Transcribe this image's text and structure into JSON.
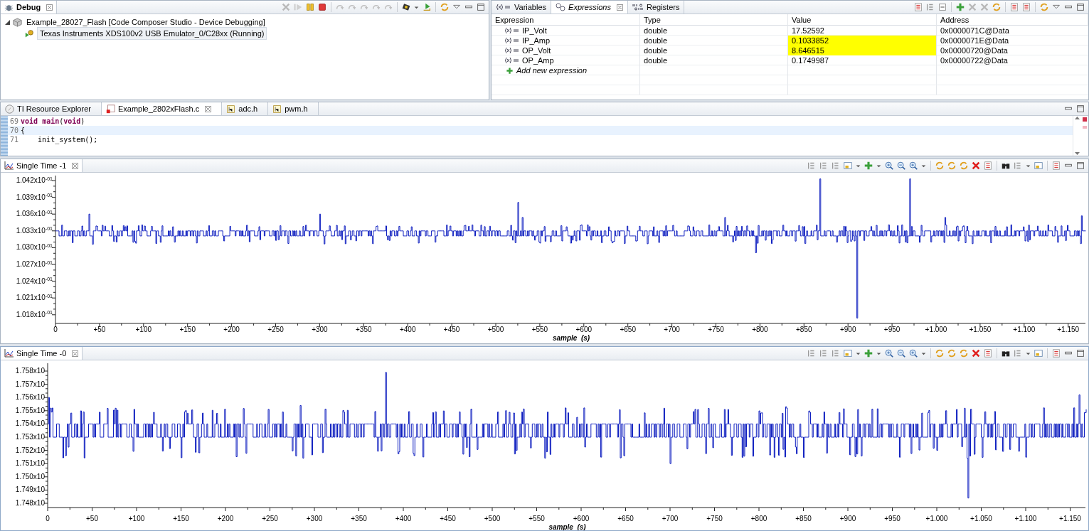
{
  "debug": {
    "title": "Debug",
    "tree": [
      {
        "label": "Example_28027_Flash [Code Composer Studio - Device Debugging]",
        "expanded": true,
        "selected": false,
        "children": [
          {
            "label": "Texas Instruments XDS100v2 USB Emulator_0/C28xx (Running)",
            "selected": true
          }
        ]
      }
    ]
  },
  "expressions_view": {
    "tabs": [
      {
        "label": "Variables",
        "selected": false
      },
      {
        "label": "Expressions",
        "selected": true
      },
      {
        "label": "Registers",
        "selected": false
      }
    ],
    "columns": [
      "Expression",
      "Type",
      "Value",
      "Address"
    ],
    "rows": [
      {
        "expression": "IP_Volt",
        "type": "double",
        "value": "17.52592",
        "changed": false,
        "address": "0x0000071C@Data"
      },
      {
        "expression": "IP_Amp",
        "type": "double",
        "value": "0.1033852",
        "changed": true,
        "address": "0x0000071E@Data"
      },
      {
        "expression": "OP_Volt",
        "type": "double",
        "value": "8.646515",
        "changed": true,
        "address": "0x00000720@Data"
      },
      {
        "expression": "OP_Amp",
        "type": "double",
        "value": "0.1749987",
        "changed": false,
        "address": "0x00000722@Data"
      }
    ],
    "add_label": "Add new expression"
  },
  "editor": {
    "tabs": [
      {
        "label": "TI Resource Explorer",
        "selected": false
      },
      {
        "label": "Example_2802xFlash.c",
        "selected": true
      },
      {
        "label": "adc.h",
        "selected": false
      },
      {
        "label": "pwm.h",
        "selected": false
      }
    ],
    "lines": [
      {
        "number": "69",
        "code": "**void** **main**(**void**)",
        "current": false
      },
      {
        "number": "70",
        "code": "{",
        "current": true
      },
      {
        "number": "71",
        "code": "    init_system();",
        "current": false
      }
    ]
  },
  "graphs": [
    {
      "title": "Single Time -1",
      "y_tick_labels": [
        "1.042x10$^{-01}$",
        "1.039x10$^{-01}$",
        "1.036x10$^{-01}$",
        "1.033x10$^{-01}$",
        "1.030x10$^{-01}$",
        "1.027x10$^{-01}$",
        "1.024x10$^{-01}$",
        "1.021x10$^{-01}$",
        "1.018x10$^{-01}$"
      ],
      "x_tick_labels": [
        "0",
        "+50",
        "+100",
        "+150",
        "+200",
        "+250",
        "+300",
        "+350",
        "+400",
        "+450",
        "+500",
        "+550",
        "+600",
        "+650",
        "+700",
        "+750",
        "+800",
        "+850",
        "+900",
        "+950",
        "+1.000",
        "+1.050",
        "+1.100",
        "+1.150"
      ],
      "xlabel": "sample  (s)"
    },
    {
      "title": "Single Time -0",
      "y_tick_labels": [
        "1.758x10",
        "1.757x10",
        "1.756x10",
        "1.755x10",
        "1.754x10",
        "1.753x10",
        "1.752x10",
        "1.751x10",
        "1.750x10",
        "1.749x10",
        "1.748x10"
      ],
      "x_tick_labels": [
        "0",
        "+50",
        "+100",
        "+150",
        "+200",
        "+250",
        "+300",
        "+350",
        "+400",
        "+450",
        "+500",
        "+550",
        "+600",
        "+650",
        "+700",
        "+750",
        "+800",
        "+850",
        "+900",
        "+950",
        "+1.000",
        "+1.050",
        "+1.100",
        "+1.150"
      ],
      "xlabel": "sample  (s)"
    }
  ]
}
